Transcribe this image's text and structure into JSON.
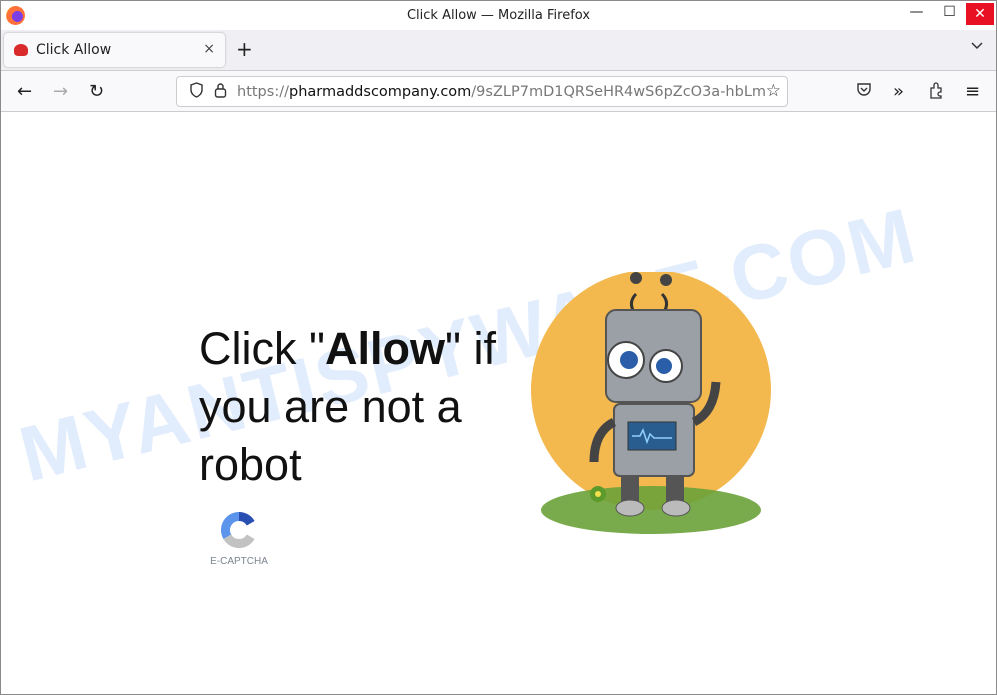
{
  "window": {
    "title": "Click Allow — Mozilla Firefox",
    "minimize": "—",
    "maximize": "☐",
    "close": "✕"
  },
  "tab": {
    "label": "Click Allow",
    "close": "×",
    "new_tab": "+",
    "list_tabs": "⌄"
  },
  "nav": {
    "back": "←",
    "forward": "→",
    "reload": "↻",
    "url_scheme": "https://",
    "url_host": "pharmaddscompany.com",
    "url_path": "/9sZLP7mD1QRSeHR4wS6pZcO3a-hbLm",
    "icons": [
      "shield-icon",
      "lock-icon",
      "star-icon",
      "pocket-icon",
      "overflow-icon",
      "extensions-icon",
      "menu-icon"
    ]
  },
  "page": {
    "headline_pre": "Click \"",
    "headline_bold": "Allow",
    "headline_post": "\" if you are not a robot",
    "captcha_label": "E-CAPTCHA"
  },
  "watermark": "MYANTISPYWARE.COM",
  "colors": {
    "close": "#e81123",
    "robot_bg": "#f3b84e",
    "grass": "#6aa23a",
    "captcha_dark": "#2a4fb3",
    "captcha_light": "#5b94ea",
    "captcha_gray": "#c2c2c2"
  }
}
